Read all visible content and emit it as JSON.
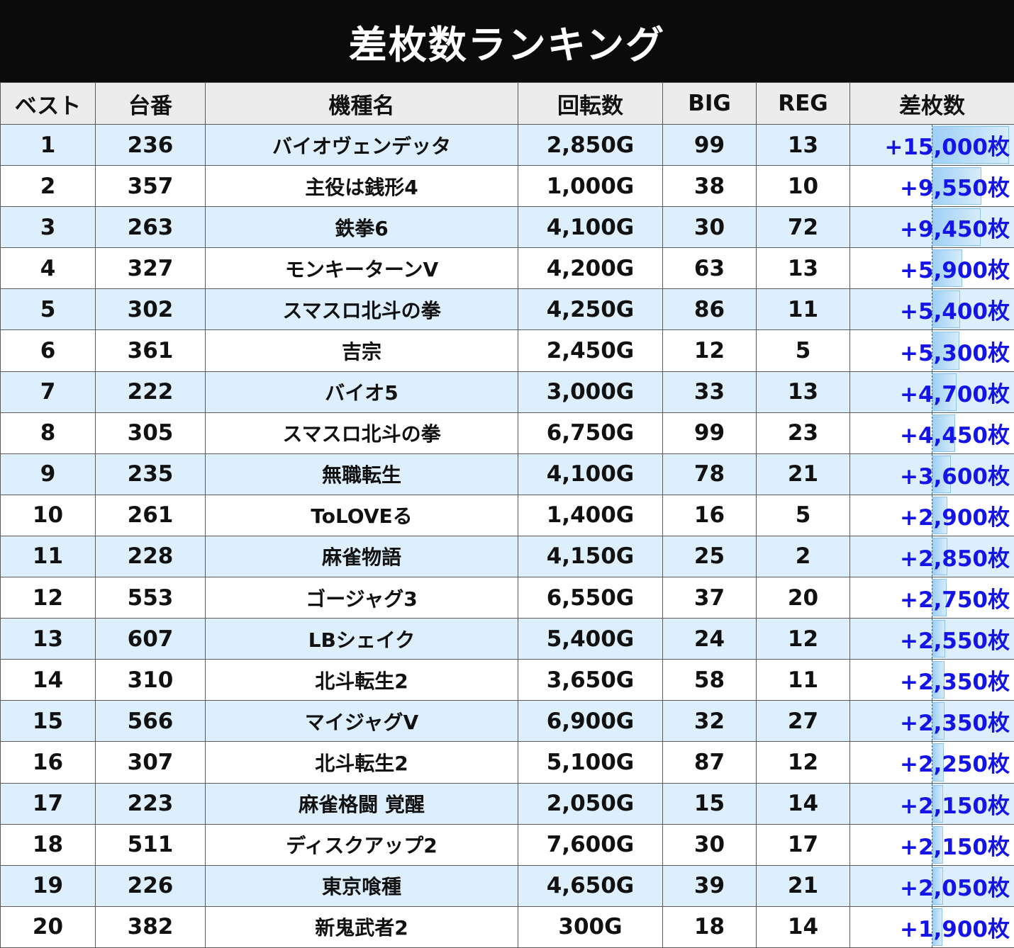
{
  "title": "差枚数ランキング",
  "columns": [
    "ベスト",
    "台番",
    "機種名",
    "回転数",
    "BIG",
    "REG",
    "差枚数"
  ],
  "max_diff": 15000,
  "rows": [
    {
      "rank": "1",
      "machine": "236",
      "name": "バイオヴェンデッタ",
      "spins": "2,850G",
      "big": "99",
      "reg": "13",
      "diff": "+15,000枚",
      "diff_value": 15000
    },
    {
      "rank": "2",
      "machine": "357",
      "name": "主役は銭形4",
      "spins": "1,000G",
      "big": "38",
      "reg": "10",
      "diff": "+9,550枚",
      "diff_value": 9550
    },
    {
      "rank": "3",
      "machine": "263",
      "name": "鉄拳6",
      "spins": "4,100G",
      "big": "30",
      "reg": "72",
      "diff": "+9,450枚",
      "diff_value": 9450
    },
    {
      "rank": "4",
      "machine": "327",
      "name": "モンキーターンV",
      "spins": "4,200G",
      "big": "63",
      "reg": "13",
      "diff": "+5,900枚",
      "diff_value": 5900
    },
    {
      "rank": "5",
      "machine": "302",
      "name": "スマスロ北斗の拳",
      "spins": "4,250G",
      "big": "86",
      "reg": "11",
      "diff": "+5,400枚",
      "diff_value": 5400
    },
    {
      "rank": "6",
      "machine": "361",
      "name": "吉宗",
      "spins": "2,450G",
      "big": "12",
      "reg": "5",
      "diff": "+5,300枚",
      "diff_value": 5300
    },
    {
      "rank": "7",
      "machine": "222",
      "name": "バイオ5",
      "spins": "3,000G",
      "big": "33",
      "reg": "13",
      "diff": "+4,700枚",
      "diff_value": 4700
    },
    {
      "rank": "8",
      "machine": "305",
      "name": "スマスロ北斗の拳",
      "spins": "6,750G",
      "big": "99",
      "reg": "23",
      "diff": "+4,450枚",
      "diff_value": 4450
    },
    {
      "rank": "9",
      "machine": "235",
      "name": "無職転生",
      "spins": "4,100G",
      "big": "78",
      "reg": "21",
      "diff": "+3,600枚",
      "diff_value": 3600
    },
    {
      "rank": "10",
      "machine": "261",
      "name": "ToLOVEる",
      "spins": "1,400G",
      "big": "16",
      "reg": "5",
      "diff": "+2,900枚",
      "diff_value": 2900
    },
    {
      "rank": "11",
      "machine": "228",
      "name": "麻雀物語",
      "spins": "4,150G",
      "big": "25",
      "reg": "2",
      "diff": "+2,850枚",
      "diff_value": 2850
    },
    {
      "rank": "12",
      "machine": "553",
      "name": "ゴージャグ3",
      "spins": "6,550G",
      "big": "37",
      "reg": "20",
      "diff": "+2,750枚",
      "diff_value": 2750
    },
    {
      "rank": "13",
      "machine": "607",
      "name": "LBシェイク",
      "spins": "5,400G",
      "big": "24",
      "reg": "12",
      "diff": "+2,550枚",
      "diff_value": 2550
    },
    {
      "rank": "14",
      "machine": "310",
      "name": "北斗転生2",
      "spins": "3,650G",
      "big": "58",
      "reg": "11",
      "diff": "+2,350枚",
      "diff_value": 2350
    },
    {
      "rank": "15",
      "machine": "566",
      "name": "マイジャグV",
      "spins": "6,900G",
      "big": "32",
      "reg": "27",
      "diff": "+2,350枚",
      "diff_value": 2350
    },
    {
      "rank": "16",
      "machine": "307",
      "name": "北斗転生2",
      "spins": "5,100G",
      "big": "87",
      "reg": "12",
      "diff": "+2,250枚",
      "diff_value": 2250
    },
    {
      "rank": "17",
      "machine": "223",
      "name": "麻雀格闘 覚醒",
      "spins": "2,050G",
      "big": "15",
      "reg": "14",
      "diff": "+2,150枚",
      "diff_value": 2150
    },
    {
      "rank": "18",
      "machine": "511",
      "name": "ディスクアップ2",
      "spins": "7,600G",
      "big": "30",
      "reg": "17",
      "diff": "+2,150枚",
      "diff_value": 2150
    },
    {
      "rank": "19",
      "machine": "226",
      "name": "東京喰種",
      "spins": "4,650G",
      "big": "39",
      "reg": "21",
      "diff": "+2,050枚",
      "diff_value": 2050
    },
    {
      "rank": "20",
      "machine": "382",
      "name": "新鬼武者2",
      "spins": "300G",
      "big": "18",
      "reg": "14",
      "diff": "+1,900枚",
      "diff_value": 1900
    }
  ]
}
